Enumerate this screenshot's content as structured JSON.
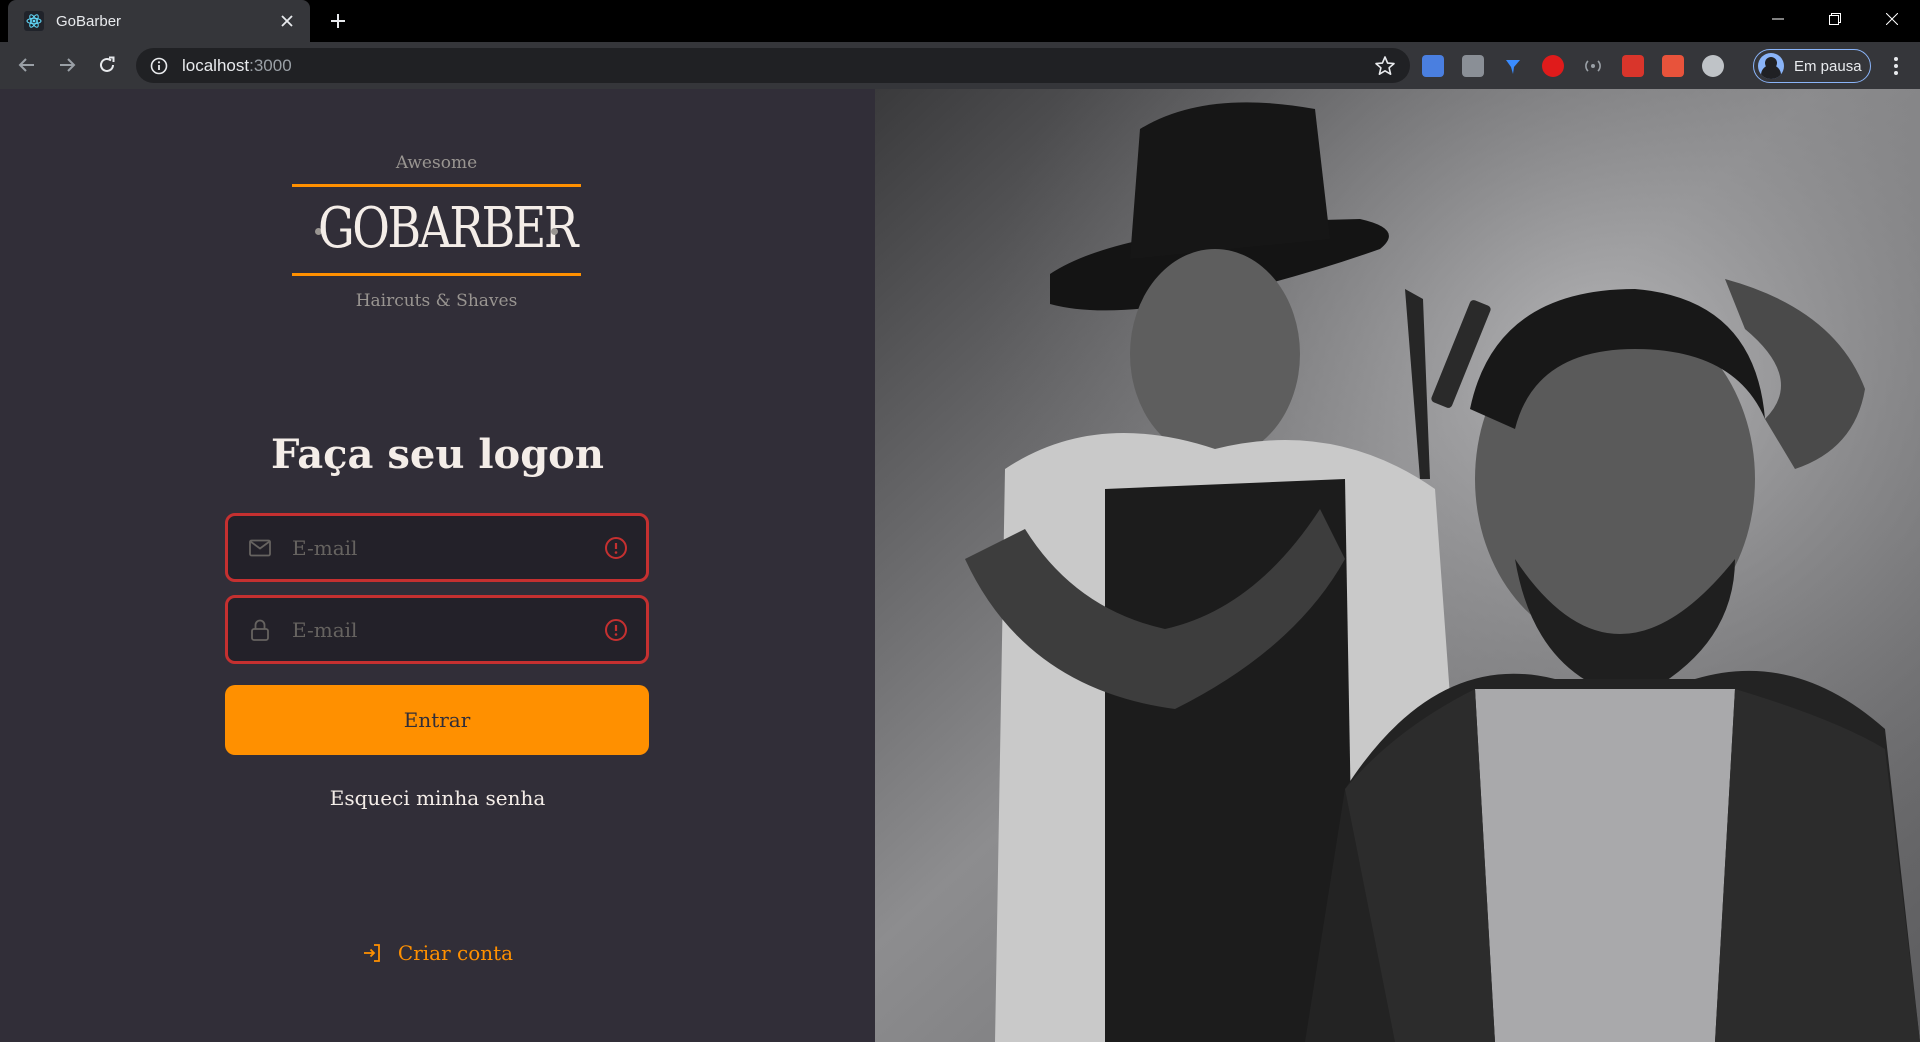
{
  "browser": {
    "tab_title": "GoBarber",
    "url_host": "localhost",
    "url_port": ":3000",
    "profile_label": "Em pausa"
  },
  "logo": {
    "top_text": "Awesome",
    "name": "GOBARBER",
    "bottom_text": "Haircuts & Shaves",
    "accent_color": "#ff9000"
  },
  "form": {
    "title": "Faça seu logon",
    "email_placeholder": "E-mail",
    "password_placeholder": "E-mail",
    "submit_label": "Entrar",
    "forgot_label": "Esqueci minha senha",
    "error_color": "#c53030"
  },
  "footer": {
    "create_account_label": "Criar conta"
  },
  "hero": {
    "image_icon": "barber-photo"
  }
}
